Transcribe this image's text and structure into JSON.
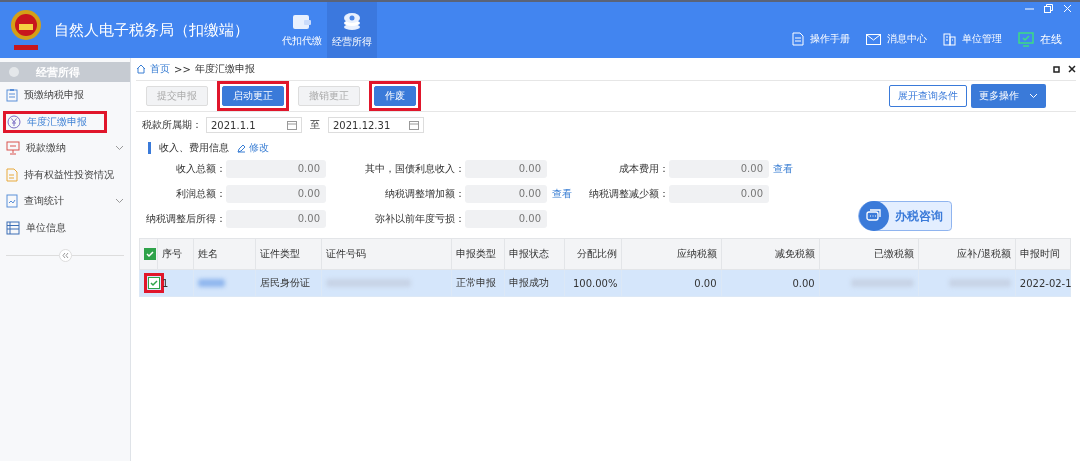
{
  "app": {
    "title": "自然人电子税务局（扣缴端）"
  },
  "modules": [
    {
      "label": "代扣代缴",
      "selected": false
    },
    {
      "label": "经营所得",
      "selected": true
    }
  ],
  "header_links": [
    "操作手册",
    "消息中心",
    "单位管理",
    "在线"
  ],
  "sidebar": {
    "title": "经营所得",
    "items": [
      {
        "label": "预缴纳税申报",
        "selected": false,
        "expandable": false,
        "annotated": false
      },
      {
        "label": "年度汇缴申报",
        "selected": true,
        "expandable": false,
        "annotated": true
      },
      {
        "label": "税款缴纳",
        "selected": false,
        "expandable": true,
        "annotated": false
      },
      {
        "label": "持有权益性投资情况",
        "selected": false,
        "expandable": false,
        "annotated": false
      },
      {
        "label": "查询统计",
        "selected": false,
        "expandable": true,
        "annotated": false
      },
      {
        "label": "单位信息",
        "selected": false,
        "expandable": false,
        "annotated": false
      }
    ]
  },
  "breadcrumb": {
    "home": "首页",
    "separator": ">>",
    "current": "年度汇缴申报"
  },
  "toolbar": {
    "actions": [
      {
        "label": "提交申报",
        "disabled": true,
        "annotated": false
      },
      {
        "label": "启动更正",
        "disabled": false,
        "annotated": true
      },
      {
        "label": "撤销更正",
        "disabled": true,
        "annotated": false
      },
      {
        "label": "作废",
        "disabled": false,
        "annotated": true
      }
    ],
    "expand_button": "展开查询条件",
    "more_button": "更多操作"
  },
  "period": {
    "label": "税款所属期：",
    "from": "2021.1.1",
    "to_label": "至",
    "to": "2021.12.31"
  },
  "section": {
    "title": "收入、费用信息",
    "edit_link": "修改"
  },
  "fields": [
    {
      "label": "收入总额：",
      "value": "0.00"
    },
    {
      "label": "其中，国债利息收入：",
      "value": "0.00"
    },
    {
      "label": "成本费用：",
      "value": "0.00",
      "link": "查看"
    },
    {
      "label": "利润总额：",
      "value": "0.00"
    },
    {
      "label": "纳税调整增加额：",
      "value": "0.00",
      "link": "查看"
    },
    {
      "label": "纳税调整减少额：",
      "value": "0.00"
    },
    {
      "label": "纳税调整后所得：",
      "value": "0.00"
    },
    {
      "label": "弥补以前年度亏损：",
      "value": "0.00"
    }
  ],
  "consult_button": "办税咨询",
  "table": {
    "all_checked": true,
    "columns": [
      "序号",
      "姓名",
      "证件类型",
      "证件号码",
      "申报类型",
      "申报状态",
      "分配比例",
      "应纳税额",
      "减免税额",
      "已缴税额",
      "应补/退税额",
      "申报时间"
    ],
    "rows": [
      {
        "checked": true,
        "selected": true,
        "annotated": true,
        "cells": [
          {
            "kind": "text",
            "text": "1"
          },
          {
            "kind": "blurred"
          },
          {
            "kind": "text",
            "text": "居民身份证"
          },
          {
            "kind": "blurred"
          },
          {
            "kind": "text",
            "text": "正常申报"
          },
          {
            "kind": "text",
            "text": "申报成功"
          },
          {
            "kind": "text",
            "text": "100.00%"
          },
          {
            "kind": "text",
            "text": "0.00"
          },
          {
            "kind": "text",
            "text": "0.00"
          },
          {
            "kind": "blurred"
          },
          {
            "kind": "blurred"
          },
          {
            "kind": "text",
            "text": "2022-02-1"
          }
        ]
      }
    ]
  }
}
